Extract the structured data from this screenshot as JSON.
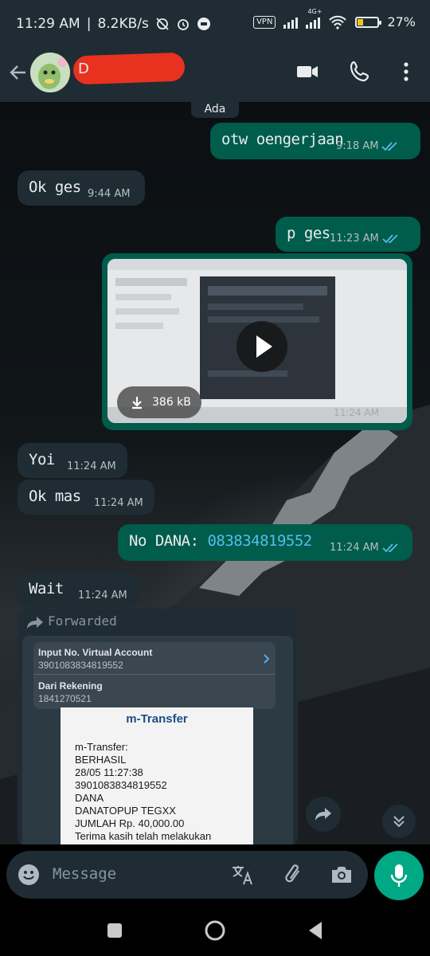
{
  "status_bar": {
    "time": "11:29 AM",
    "net_speed": "8.2KB/s",
    "vpn": "VPN",
    "network_type": "4G+",
    "battery": "27%"
  },
  "header": {
    "contact_name": "D"
  },
  "chat": {
    "date_chip": "Ada",
    "messages": [
      {
        "dir": "out",
        "text": "otw oengerjaan",
        "time": "9:18 AM"
      },
      {
        "dir": "in",
        "text": "Ok ges",
        "time": "9:44 AM"
      },
      {
        "dir": "out",
        "text": "p ges",
        "time": "11:23 AM"
      },
      {
        "dir": "out",
        "type": "video",
        "size": "386 kB",
        "time": "11:24 AM"
      },
      {
        "dir": "in",
        "text": "Yoi",
        "time": "11:24 AM"
      },
      {
        "dir": "in",
        "text": "Ok mas",
        "time": "11:24 AM"
      },
      {
        "dir": "out",
        "prefix": "No DANA: ",
        "link": "083834819552",
        "time": "11:24 AM"
      },
      {
        "dir": "in",
        "text": "Wait",
        "time": "11:24 AM"
      }
    ],
    "forwarded": {
      "label": "Forwarded",
      "form": {
        "field1_label": "Input No. Virtual Account",
        "field1_value": "3901083834819552",
        "field2_label": "Dari Rekening",
        "field2_value": "1841270521"
      },
      "receipt": {
        "title": "m-Transfer",
        "lines": [
          "m-Transfer:",
          "BERHASIL",
          "28/05 11:27:38",
          "3901083834819552",
          "DANA",
          "DANATOPUP TEGXX",
          "JUMLAH Rp. 40,000.00",
          "Terima kasih telah melakukan"
        ]
      }
    }
  },
  "input": {
    "placeholder": "Message"
  },
  "colors": {
    "header_bg": "#1f2c34",
    "incoming_bubble": "#1f2c34",
    "outgoing_bubble": "#005c4b",
    "accent": "#00a884",
    "link": "#53bdeb",
    "read_ticks": "#53bdeb"
  },
  "icons": {
    "back": "arrow-left-icon",
    "video_call": "video-camera-icon",
    "voice_call": "phone-icon",
    "menu": "more-vertical-icon",
    "emoji": "emoji-icon",
    "translate": "translate-icon",
    "attach": "paperclip-icon",
    "camera": "camera-icon",
    "mic": "microphone-icon",
    "forward": "forward-arrow-icon",
    "scroll": "chevron-double-down-icon"
  }
}
